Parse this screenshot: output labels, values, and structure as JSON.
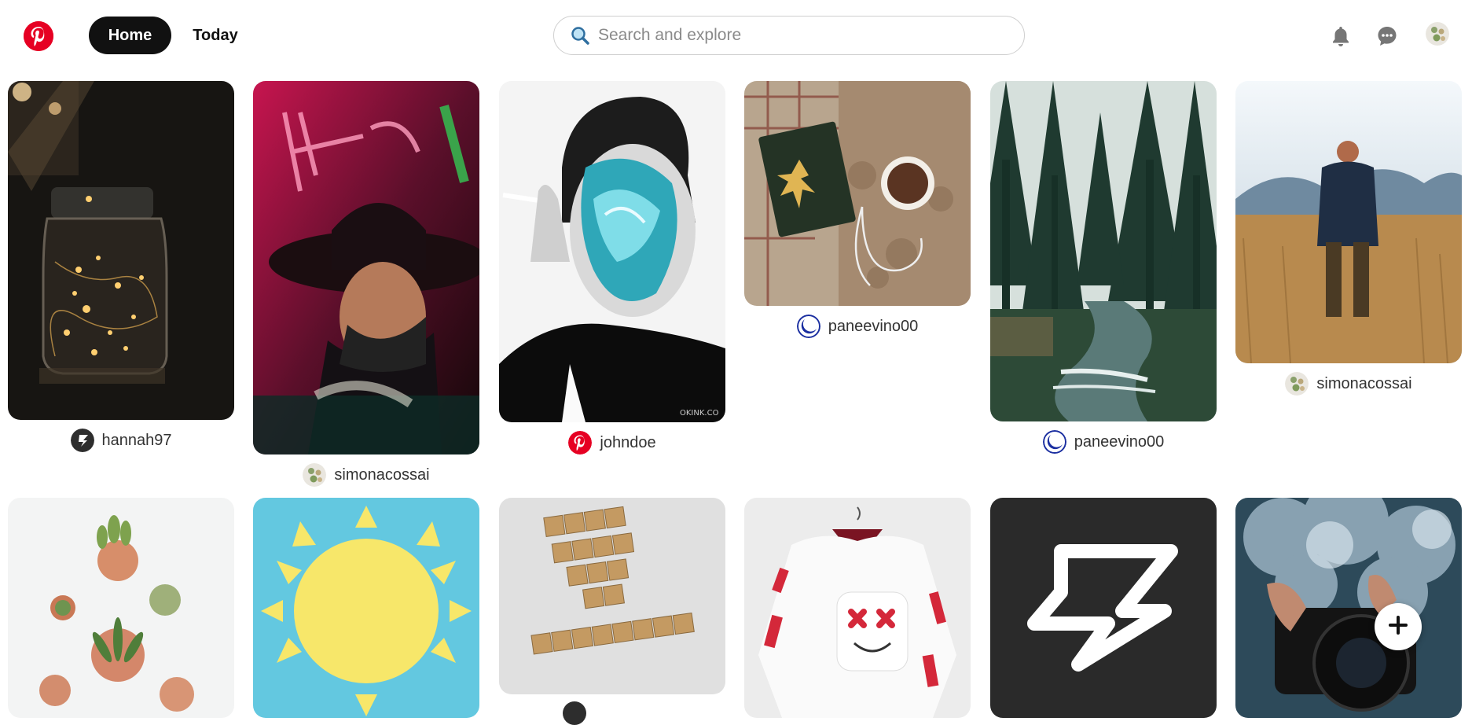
{
  "header": {
    "logo_icon": "pinterest-logo",
    "nav": [
      {
        "label": "Home",
        "active": true
      },
      {
        "label": "Today",
        "active": false
      }
    ],
    "search": {
      "placeholder": "Search and explore",
      "value": "",
      "icon": "search-icon"
    },
    "icons": [
      "bell-icon",
      "chat-icon",
      "avatar"
    ]
  },
  "pins": [
    {
      "user": "hannah97",
      "avatar": "brand-z-avatar"
    },
    {
      "user": "simonacossai",
      "avatar": "succulent-avatar"
    },
    {
      "user": "johndoe",
      "avatar": "pinterest-avatar"
    },
    {
      "user": "paneevino00",
      "avatar": "moon-avatar"
    },
    {
      "user": "paneevino00",
      "avatar": "moon-avatar"
    },
    {
      "user": "simonacossai",
      "avatar": "succulent-avatar"
    },
    {
      "user": "",
      "avatar": ""
    },
    {
      "user": "",
      "avatar": ""
    },
    {
      "user": "",
      "avatar": ""
    },
    {
      "user": "",
      "avatar": ""
    },
    {
      "user": "",
      "avatar": ""
    },
    {
      "user": "",
      "avatar": ""
    }
  ],
  "fab": {
    "icon": "plus-icon"
  },
  "colors": {
    "brand": "#e60023",
    "nav_active_bg": "#111111"
  }
}
